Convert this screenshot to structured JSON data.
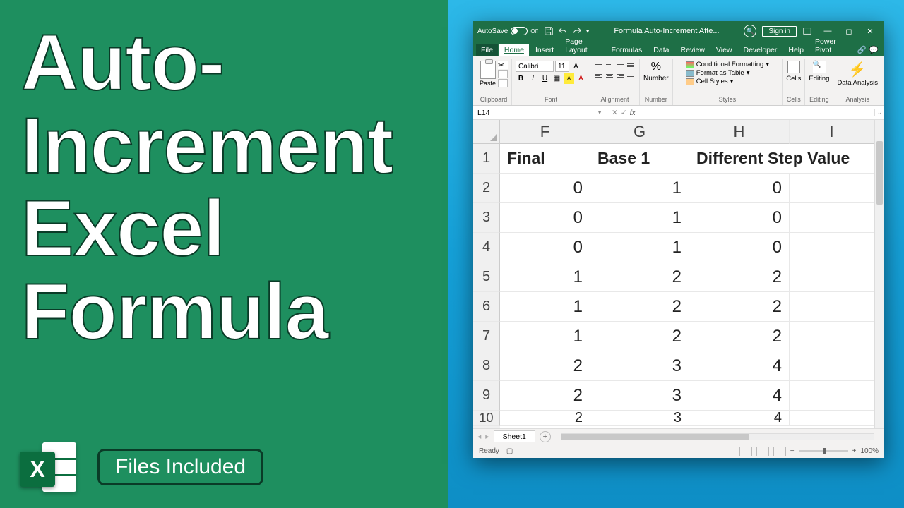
{
  "left": {
    "title_l1": "Auto-",
    "title_l2": "Increment",
    "title_l3": "Excel",
    "title_l4": "Formula",
    "logo_letter": "X",
    "files_badge": "Files Included"
  },
  "titlebar": {
    "autosave": "AutoSave",
    "autosave_state": "Off",
    "doc_title": "Formula Auto-Increment Afte...",
    "signin": "Sign in"
  },
  "tabs": {
    "file": "File",
    "home": "Home",
    "insert": "Insert",
    "page_layout": "Page Layout",
    "formulas": "Formulas",
    "data": "Data",
    "review": "Review",
    "view": "View",
    "developer": "Developer",
    "help": "Help",
    "power_pivot": "Power Pivot"
  },
  "ribbon": {
    "paste": "Paste",
    "clipboard": "Clipboard",
    "font_name": "Calibri",
    "font_size": "11",
    "font": "Font",
    "alignment": "Alignment",
    "number": "Number",
    "cond_fmt": "Conditional Formatting",
    "fmt_table": "Format as Table",
    "cell_styles": "Cell Styles",
    "styles": "Styles",
    "cells": "Cells",
    "editing": "Editing",
    "data_analysis": "Data Analysis",
    "analysis": "Analysis"
  },
  "namebox": {
    "ref": "L14"
  },
  "columns": {
    "F": "F",
    "G": "G",
    "H": "H",
    "I": "I"
  },
  "headers": {
    "F": "Final",
    "G": "Base 1",
    "H": "Different Step Value",
    "I": ""
  },
  "rows": [
    {
      "n": "1"
    },
    {
      "n": "2",
      "F": "0",
      "G": "1",
      "H": "0"
    },
    {
      "n": "3",
      "F": "0",
      "G": "1",
      "H": "0"
    },
    {
      "n": "4",
      "F": "0",
      "G": "1",
      "H": "0"
    },
    {
      "n": "5",
      "F": "1",
      "G": "2",
      "H": "2"
    },
    {
      "n": "6",
      "F": "1",
      "G": "2",
      "H": "2"
    },
    {
      "n": "7",
      "F": "1",
      "G": "2",
      "H": "2"
    },
    {
      "n": "8",
      "F": "2",
      "G": "3",
      "H": "4"
    },
    {
      "n": "9",
      "F": "2",
      "G": "3",
      "H": "4"
    },
    {
      "n": "10",
      "F": "2",
      "G": "3",
      "H": "4"
    }
  ],
  "sheet": {
    "name": "Sheet1"
  },
  "status": {
    "ready": "Ready",
    "zoom": "100%"
  }
}
